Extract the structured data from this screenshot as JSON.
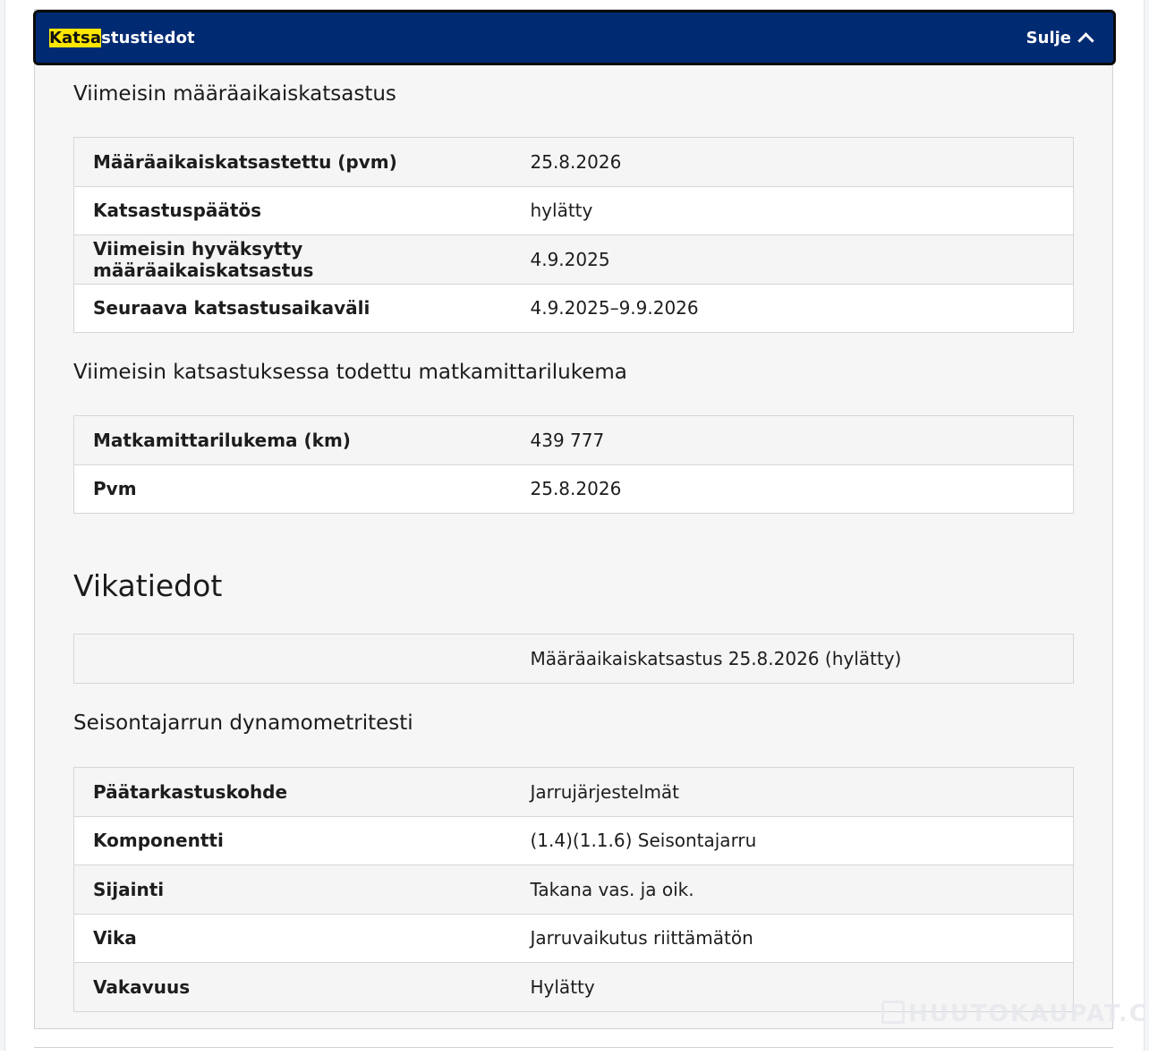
{
  "accordion": {
    "title_highlight": "Katsa",
    "title_rest": "stustiedot",
    "toggle_label": "Sulje"
  },
  "inspection": {
    "heading": "Viimeisin määräaikaiskatsastus",
    "rows": [
      {
        "key": "Määräaikaiskatsastettu (pvm)",
        "value": "25.8.2026"
      },
      {
        "key": "Katsastuspäätös",
        "value": "hylätty"
      },
      {
        "key": "Viimeisin hyväksytty määräaikaiskatsastus",
        "value": "4.9.2025"
      },
      {
        "key": "Seuraava katsastusaikaväli",
        "value": "4.9.2025–9.9.2026"
      }
    ]
  },
  "odometer": {
    "heading": "Viimeisin katsastuksessa todettu matkamittarilukema",
    "rows": [
      {
        "key": "Matkamittarilukema (km)",
        "value": "439 777"
      },
      {
        "key": "Pvm",
        "value": "25.8.2026"
      }
    ]
  },
  "faults": {
    "heading": "Vikatiedot",
    "summary_row": {
      "key": "",
      "value": "Määräaikaiskatsastus 25.8.2026 (hylätty)"
    },
    "fault_heading": "Seisontajarrun dynamometritesti",
    "rows": [
      {
        "key": "Päätarkastuskohde",
        "value": "Jarrujärjestelmät"
      },
      {
        "key": "Komponentti",
        "value": "(1.4)(1.1.6) Seisontajarru"
      },
      {
        "key": "Sijainti",
        "value": "Takana vas. ja oik."
      },
      {
        "key": "Vika",
        "value": "Jarruvaikutus riittämätön"
      },
      {
        "key": "Vakavuus",
        "value": "Hylätty"
      }
    ]
  },
  "watermark": {
    "text": "HUUTOKAUPAT.CO"
  }
}
